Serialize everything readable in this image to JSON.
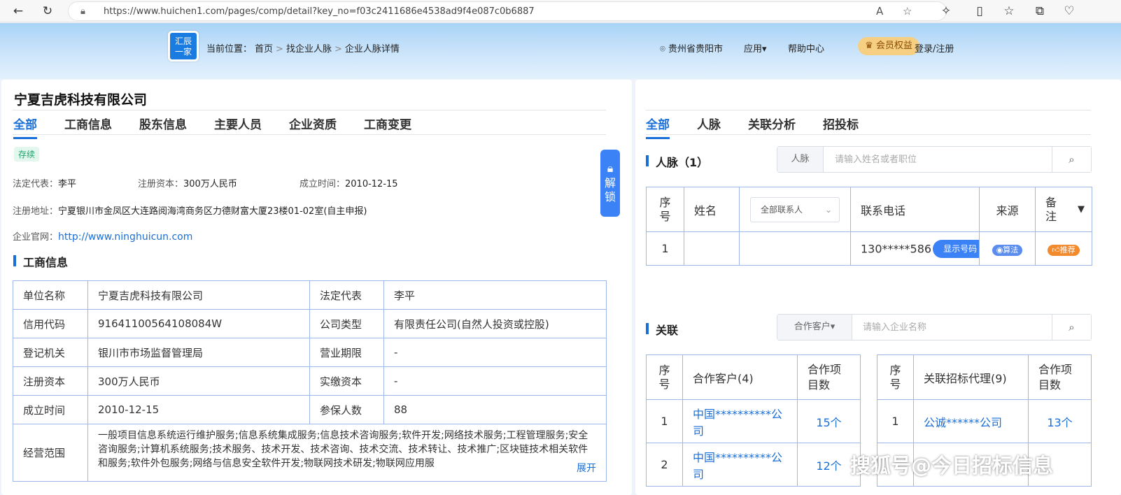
{
  "browser": {
    "url": "https://www.huichen1.com/pages/comp/detail?key_no=f03c2411686e4538ad9f4e087c0b6887"
  },
  "header": {
    "logo_line1": "汇辰",
    "logo_line2": "一家",
    "breadcrumb_label": "当前位置：",
    "breadcrumb": [
      "首页",
      "找企业人脉",
      "企业人脉详情"
    ],
    "breadcrumb_sep": ">",
    "location": "贵州省贵阳市",
    "apps": "应用",
    "help": "帮助中心",
    "vip": "会员权益",
    "login": "登录/注册"
  },
  "left": {
    "company_name": "宁夏吉虎科技有限公司",
    "tabs": [
      "全部",
      "工商信息",
      "股东信息",
      "主要人员",
      "企业资质",
      "工商变更"
    ],
    "status": "存续",
    "legal_rep_label": "法定代表：",
    "legal_rep": "李平",
    "capital_label": "注册资本：",
    "capital": "300万人民币",
    "founded_label": "成立时间：",
    "founded": "2010-12-15",
    "address_label": "注册地址：",
    "address": "宁夏银川市金凤区大连路阅海湾商务区力德财富大厦23楼01-02室(自主申报)",
    "website_label": "企业官网：",
    "website": "http://www.ninghuicun.com",
    "section_title": "工商信息",
    "table": [
      [
        "单位名称",
        "宁夏吉虎科技有限公司",
        "法定代表",
        "李平"
      ],
      [
        "信用代码",
        "91641100564108084W",
        "公司类型",
        "有限责任公司(自然人投资或控股)"
      ],
      [
        "登记机关",
        "银川市市场监督管理局",
        "营业期限",
        "-"
      ],
      [
        "注册资本",
        "300万人民币",
        "实缴资本",
        "-"
      ],
      [
        "成立时间",
        "2010-12-15",
        "参保人数",
        "88"
      ]
    ],
    "scope_label": "经营范围",
    "scope_text": "一般项目信息系统运行维护服务;信息系统集成服务;信息技术咨询服务;软件开发;网络技术服务;工程管理服务;安全咨询服务;计算机系统服务;技术服务、技术开发、技术咨询、技术交流、技术转让、技术推广;区块链技术相关软件和服务;软件外包服务;网络与信息安全软件开发;物联网技术研发;物联网应用服",
    "expand": "展开",
    "unlock": "解锁"
  },
  "right": {
    "tabs": [
      "全部",
      "人脉",
      "关联分析",
      "招投标"
    ],
    "contacts": {
      "title": "人脉（1）",
      "search_label": "人脉",
      "search_placeholder": "请输入姓名或者职位",
      "headers": {
        "index": "序号",
        "name": "姓名",
        "filter": "全部联系人",
        "phone": "联系电话",
        "source": "来源",
        "note": "备注"
      },
      "rows": [
        {
          "index": "1",
          "name": "",
          "filter": "",
          "phone": "130*****586",
          "show": "显示号码",
          "source_tag": "算法",
          "note_tag": "推荐"
        }
      ]
    },
    "related": {
      "title": "关联",
      "filter": "合作客户",
      "search_placeholder": "请输入企业名称",
      "customers": {
        "headers": [
          "序号",
          "合作客户(4)",
          "合作项目数"
        ],
        "rows": [
          [
            "1",
            "中国**********公司",
            "15个"
          ],
          [
            "2",
            "中国**********公司",
            "12个"
          ]
        ]
      },
      "agents": {
        "headers": [
          "序号",
          "关联招标代理(9)",
          "合作项目数"
        ],
        "rows": [
          [
            "1",
            "公诚******公司",
            "13个"
          ]
        ]
      }
    }
  },
  "watermark": "搜狐号@今日招标信息"
}
